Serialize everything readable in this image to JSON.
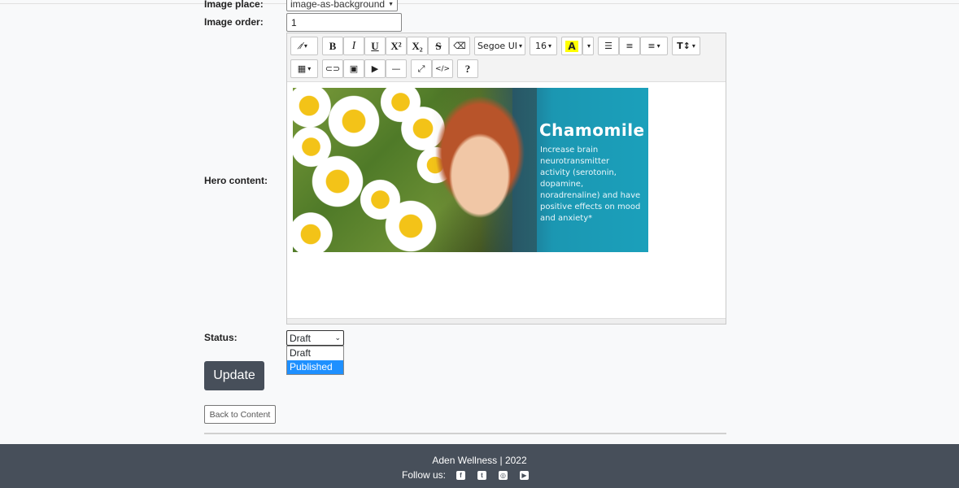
{
  "form": {
    "image_place_label": "Image place:",
    "image_place_value": "image-as-background",
    "image_order_label": "Image order:",
    "image_order_value": "1",
    "hero_content_label": "Hero content:",
    "status_label": "Status:",
    "status_value": "Draft",
    "status_options": [
      "Draft",
      "Published"
    ],
    "status_highlighted": "Published",
    "update_button": "Update",
    "back_button": "Back to Content"
  },
  "toolbar": {
    "bold": "B",
    "italic": "I",
    "underline": "U",
    "superscript": "X²",
    "subscript": "X₂",
    "strikethrough": "S",
    "font_family": "Segoe UI",
    "font_size": "16",
    "highlight": "A",
    "help": "?"
  },
  "hero_image": {
    "title": "Chamomile",
    "text": "Increase brain neurotransmitter activity (serotonin, dopamine, noradrenaline) and have positive effects on mood and anxiety*"
  },
  "footer": {
    "copyright": "Aden Wellness | 2022",
    "follow_label": "Follow us:"
  },
  "colors": {
    "footer_bg": "#474f5a",
    "update_button_bg": "#474f5a",
    "dropdown_highlight": "#1e90ff",
    "hero_panel": "#1b97b2"
  }
}
